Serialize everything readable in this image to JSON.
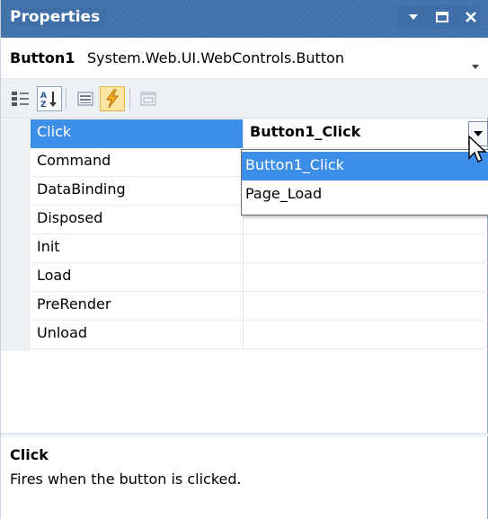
{
  "window": {
    "title": "Properties"
  },
  "selector": {
    "object_name": "Button1",
    "object_type": "System.Web.UI.WebControls.Button"
  },
  "toolbar": {
    "tools": [
      {
        "name": "categorized",
        "icon": "categorized-icon"
      },
      {
        "name": "alphabetical",
        "icon": "alphabetical-icon"
      },
      {
        "name": "properties",
        "icon": "properties-icon"
      },
      {
        "name": "events",
        "icon": "events-lightning-icon",
        "active": true
      },
      {
        "name": "property-pages",
        "icon": "property-pages-icon"
      }
    ]
  },
  "events": [
    {
      "name": "Click",
      "value": "Button1_Click",
      "selected": true
    },
    {
      "name": "Command",
      "value": ""
    },
    {
      "name": "DataBinding",
      "value": ""
    },
    {
      "name": "Disposed",
      "value": ""
    },
    {
      "name": "Init",
      "value": ""
    },
    {
      "name": "Load",
      "value": ""
    },
    {
      "name": "PreRender",
      "value": ""
    },
    {
      "name": "Unload",
      "value": ""
    }
  ],
  "dropdown": {
    "options": [
      "Button1_Click",
      "Page_Load"
    ],
    "selected": "Button1_Click"
  },
  "description": {
    "title": "Click",
    "text": "Fires when the button is clicked."
  },
  "colors": {
    "title_bar": "#3f6ea8",
    "selection": "#3d8ee8",
    "gutter": "#edf1f6",
    "active_tool": "#fbe6a1"
  }
}
